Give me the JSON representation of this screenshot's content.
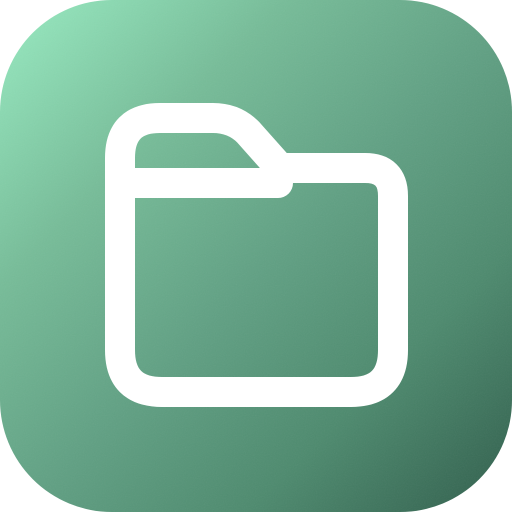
{
  "app_icon": {
    "icon": "folder-icon",
    "colors": {
      "gradient_start": "#98ecc2",
      "gradient_end": "#2f5d4b",
      "glyph": "#ffffff"
    }
  }
}
